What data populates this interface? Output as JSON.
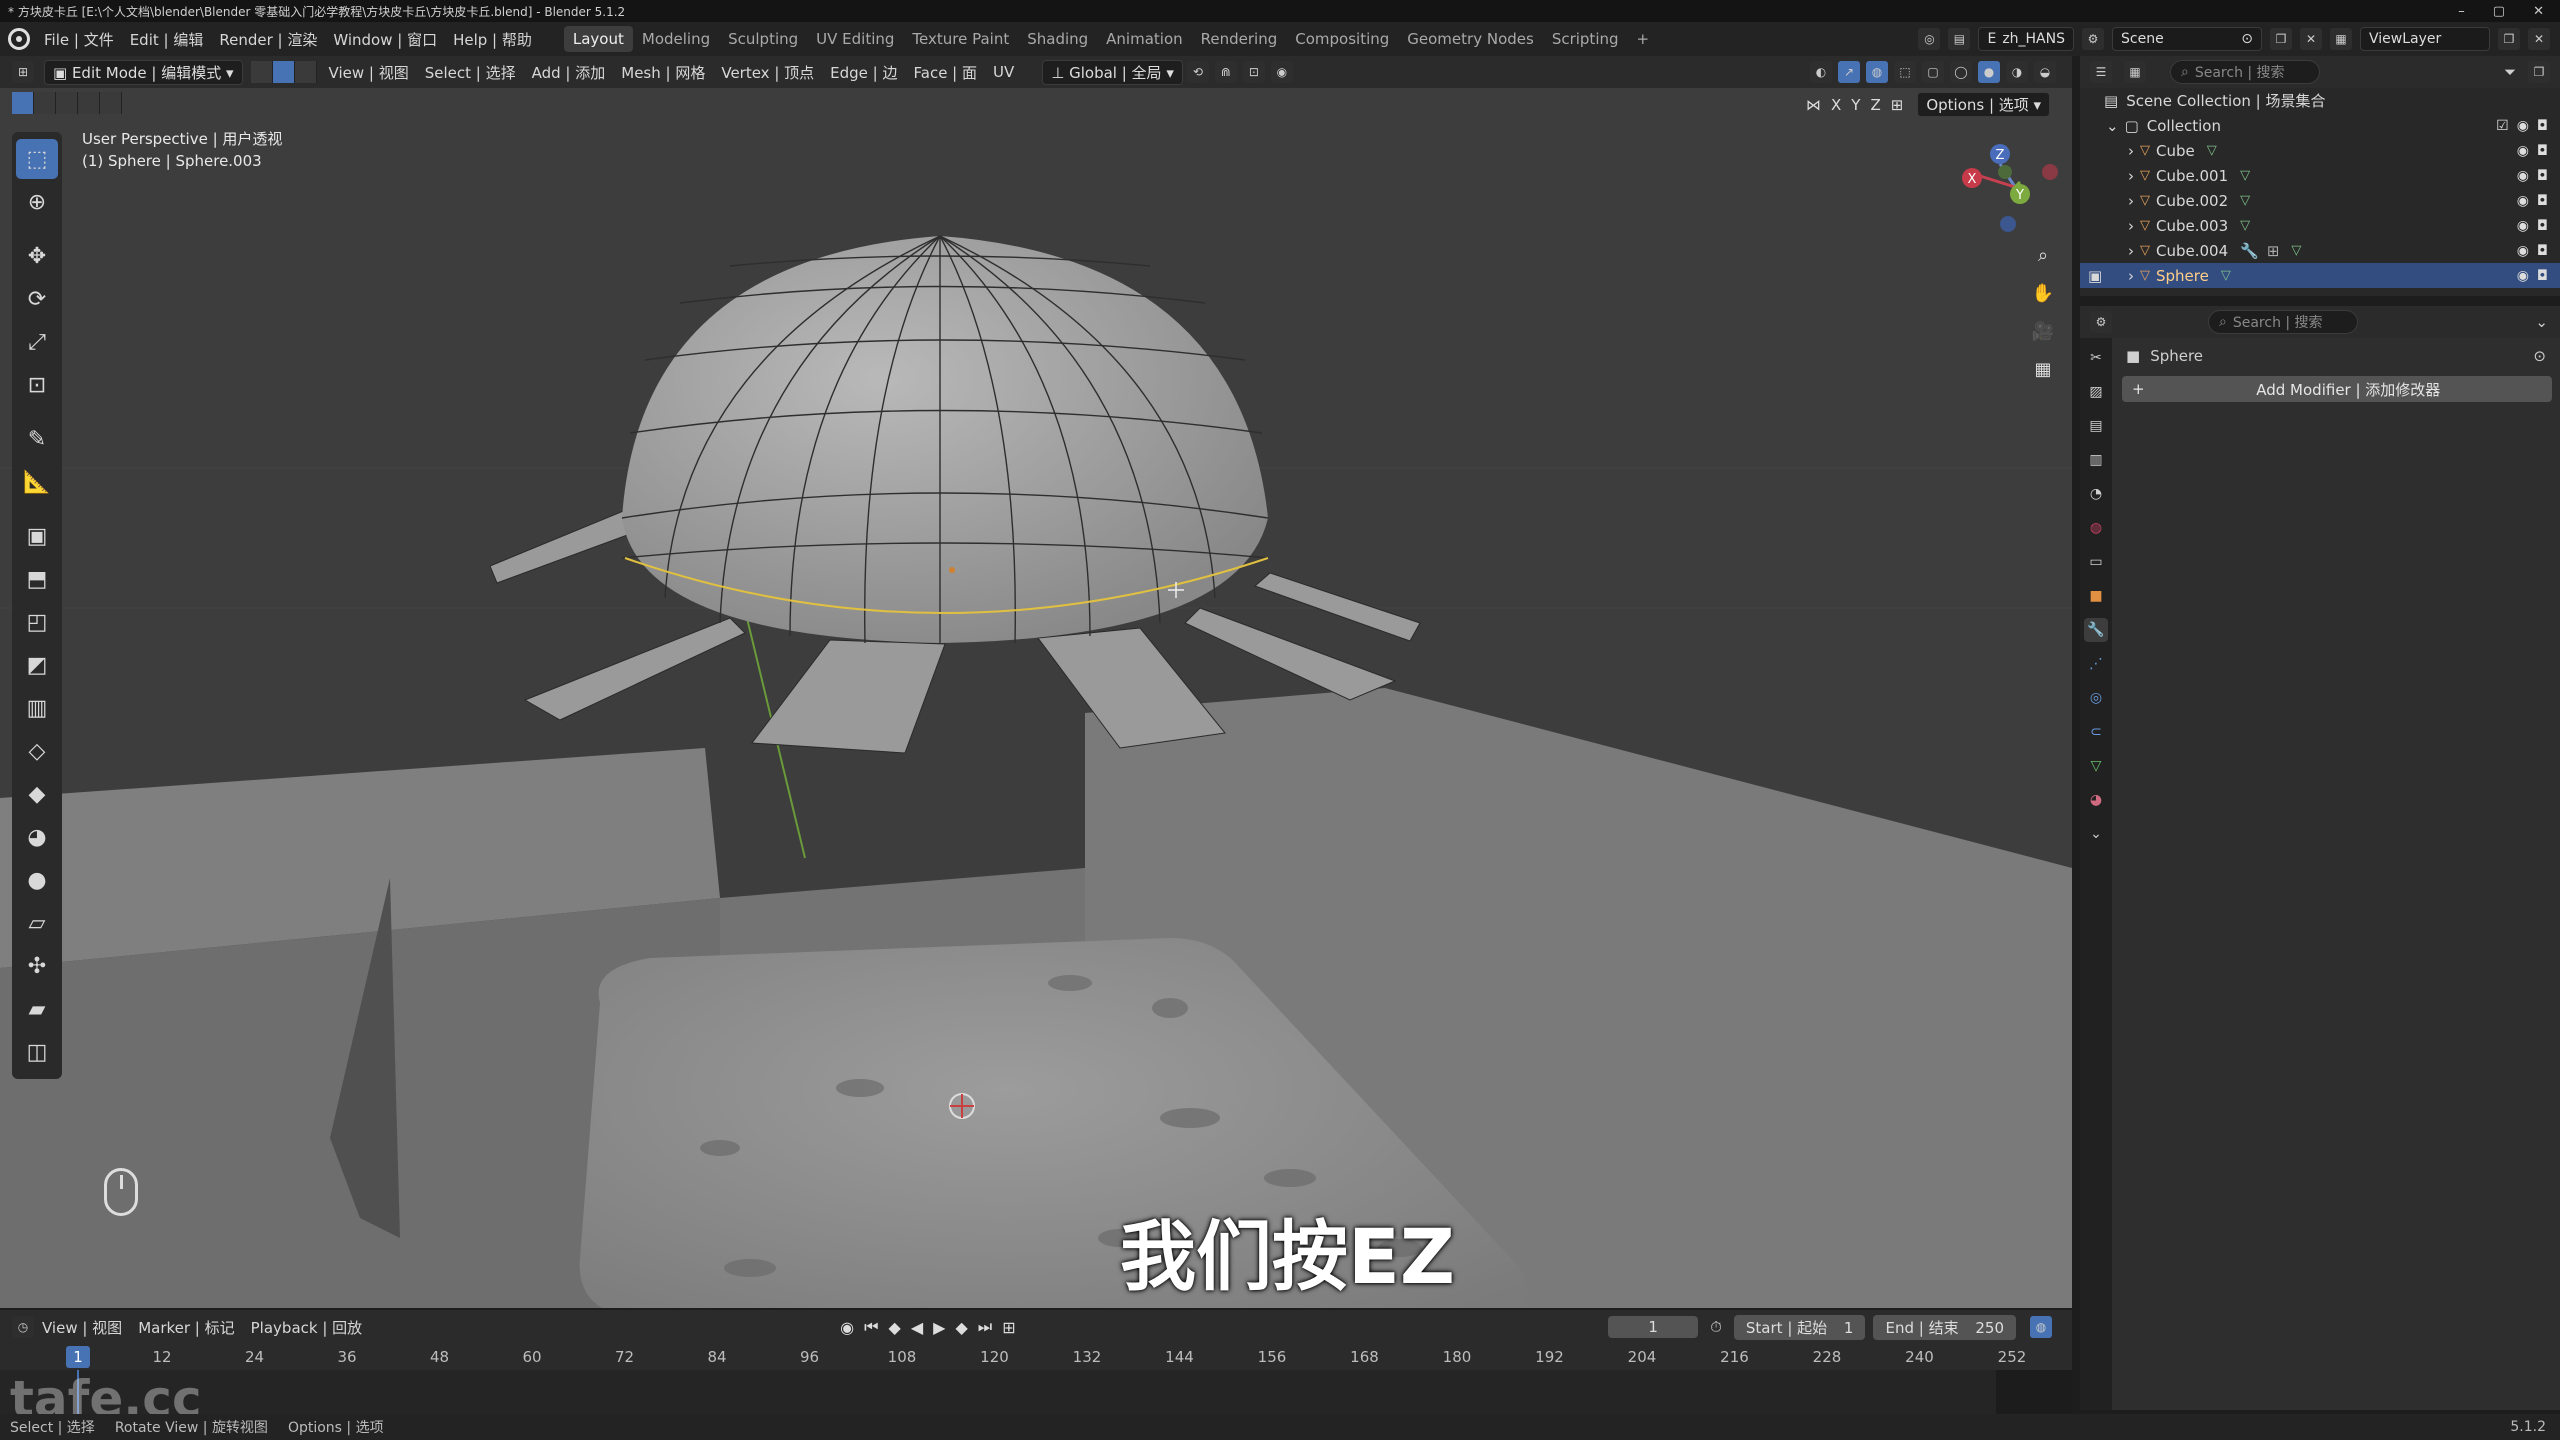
{
  "window": {
    "title": "* 方块皮卡丘 [E:\\个人文档\\blender\\Blender 零基础入门必学教程\\方块皮卡丘\\方块皮卡丘.blend] - Blender 5.1.2",
    "min": "–",
    "max": "▢",
    "close": "✕"
  },
  "menu": [
    "File | 文件",
    "Edit | 编辑",
    "Render | 渲染",
    "Window | 窗口",
    "Help | 帮助"
  ],
  "workspaces": [
    "Layout",
    "Modeling",
    "Sculpting",
    "UV Editing",
    "Texture Paint",
    "Shading",
    "Animation",
    "Rendering",
    "Compositing",
    "Geometry Nodes",
    "Scripting",
    "+"
  ],
  "top_right": {
    "language": "zh_HANS",
    "scene": "Scene",
    "view_layer": "ViewLayer"
  },
  "viewport_header": {
    "mode": "Edit Mode | 编辑模式",
    "items": [
      "View | 视图",
      "Select | 选择",
      "Add | 添加",
      "Mesh | 网格",
      "Vertex | 顶点",
      "Edge | 边",
      "Face | 面",
      "UV"
    ],
    "orientation": "Global | 全局"
  },
  "viewport_subheader": {
    "axes": [
      "X",
      "Y",
      "Z"
    ],
    "options": "Options | 选项"
  },
  "viewport": {
    "perspective": "User Perspective | 用户透视",
    "object": "(1) Sphere | Sphere.003",
    "subtitle": "我们按EZ"
  },
  "gizmo": {
    "x": "X",
    "y": "Y",
    "z": "Z"
  },
  "timeline_header": {
    "items": [
      "View | 视图",
      "Marker | 标记",
      "Playback | 回放"
    ],
    "current_frame": "1",
    "start": "Start | 起始",
    "start_value": "1",
    "end": "End | 结束",
    "end_value": "250"
  },
  "timeline_ticks": [
    "1",
    "12",
    "24",
    "36",
    "48",
    "60",
    "72",
    "84",
    "96",
    "108",
    "120",
    "132",
    "144",
    "156",
    "168",
    "180",
    "192",
    "204",
    "216",
    "228",
    "240",
    "252"
  ],
  "outliner": {
    "search_placeholder": "Search | 搜索",
    "root": "Scene Collection | 场景集合",
    "collection": "Collection",
    "objects": [
      "Cube",
      "Cube.001",
      "Cube.002",
      "Cube.003",
      "Cube.004",
      "Sphere"
    ]
  },
  "properties": {
    "search_placeholder": "Search | 搜索",
    "object_name": "Sphere",
    "add_modifier": "Add Modifier | 添加修改器"
  },
  "statusbar": {
    "select": "Select | 选择",
    "rotate": "Rotate View | 旋转视图",
    "options": "Options | 选项",
    "version": "5.1.2"
  },
  "watermark": "tafe.cc",
  "colors": {
    "accent": "#4772b3",
    "selected_row": "#334d80",
    "edge_highlight": "#e0c040"
  }
}
